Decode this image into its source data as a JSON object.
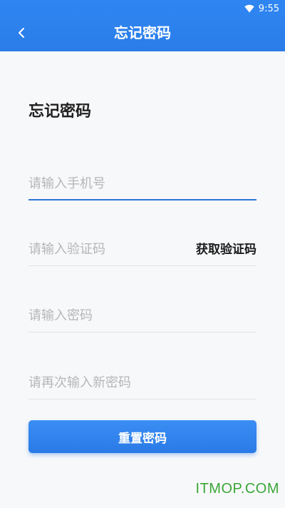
{
  "status_bar": {
    "time": "9:55",
    "icon": "wifi-icon"
  },
  "app_bar": {
    "title": "忘记密码",
    "back_icon": "chevron-left-icon",
    "color": "#2f86f2"
  },
  "form": {
    "heading": "忘记密码",
    "phone_placeholder": "请输入手机号",
    "code_placeholder": "请输入验证码",
    "get_code_label": "获取验证码",
    "password_placeholder": "请输入密码",
    "confirm_password_placeholder": "请再次输入新密码",
    "submit_label": "重置密码"
  },
  "watermark": "ITMOP.COM"
}
